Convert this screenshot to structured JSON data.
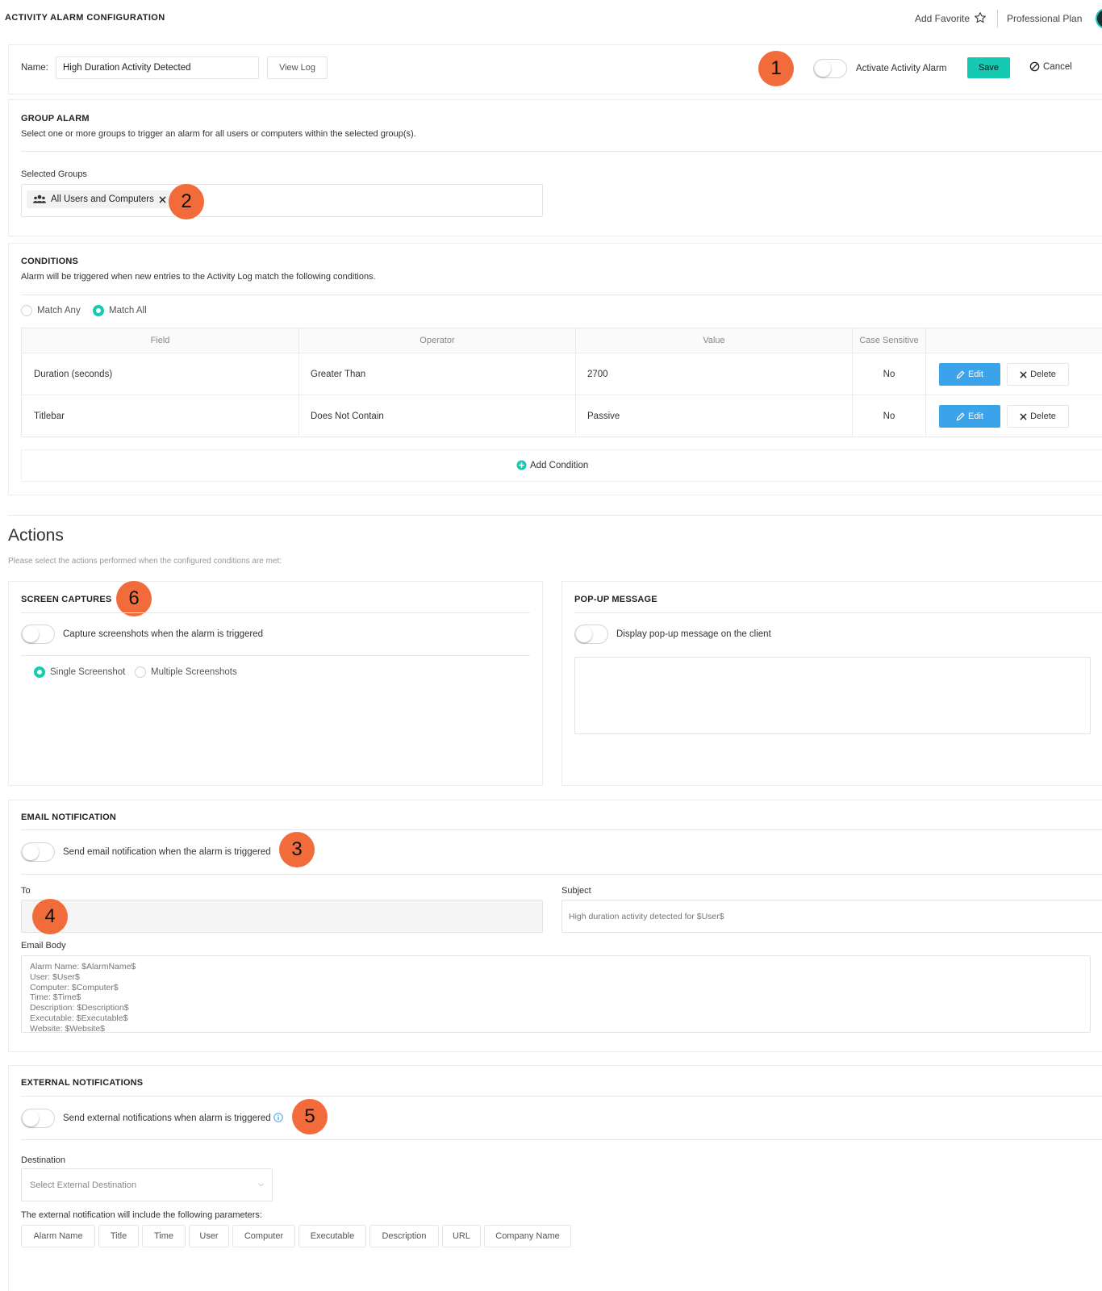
{
  "header": {
    "title": "ACTIVITY ALARM CONFIGURATION",
    "add_favorite": "Add Favorite",
    "plan": "Professional Plan"
  },
  "top_bar": {
    "name_label": "Name:",
    "name_value": "High Duration Activity Detected",
    "view_log": "View Log",
    "activate_label": "Activate Activity Alarm",
    "save": "Save",
    "cancel": "Cancel"
  },
  "markers": [
    "1",
    "2",
    "3",
    "4",
    "5",
    "6"
  ],
  "group_alarm": {
    "title": "GROUP ALARM",
    "description": "Select one or more groups to trigger an alarm for all users or computers within the selected group(s).",
    "selected_label": "Selected Groups",
    "chip": "All Users and Computers"
  },
  "conditions": {
    "title": "CONDITIONS",
    "description": "Alarm will be triggered when new entries to the Activity Log match the following conditions.",
    "match_any": "Match Any",
    "match_all": "Match All",
    "selected_match": "all",
    "columns": [
      "Field",
      "Operator",
      "Value",
      "Case Sensitive"
    ],
    "rows": [
      {
        "field": "Duration (seconds)",
        "operator": "Greater Than",
        "value": "2700",
        "case_sensitive": "No"
      },
      {
        "field": "Titlebar",
        "operator": "Does Not Contain",
        "value": "Passive",
        "case_sensitive": "No"
      }
    ],
    "edit": "Edit",
    "delete": "Delete",
    "add_condition": "Add Condition"
  },
  "actions": {
    "title": "Actions",
    "description": "Please select the actions performed when the configured conditions are met:"
  },
  "screen_captures": {
    "title": "SCREEN CAPTURES",
    "toggle_label": "Capture screenshots when the alarm is triggered",
    "single": "Single Screenshot",
    "multiple": "Multiple Screenshots"
  },
  "popup": {
    "title": "POP-UP MESSAGE",
    "toggle_label": "Display pop-up message on the client"
  },
  "email": {
    "title": "EMAIL NOTIFICATION",
    "toggle_label": "Send email notification when the alarm is triggered",
    "to_label": "To",
    "subject_label": "Subject",
    "subject_placeholder": "High duration activity detected for $User$",
    "body_label": "Email Body",
    "body_placeholder": "Alarm Name: $AlarmName$\nUser: $User$\nComputer: $Computer$\nTime: $Time$\nDescription: $Description$\nExecutable: $Executable$\nWebsite: $Website$"
  },
  "external": {
    "title": "EXTERNAL NOTIFICATIONS",
    "toggle_label": "Send external notifications when alarm is triggered",
    "destination_label": "Destination",
    "destination_placeholder": "Select External Destination",
    "params_label": "The external notification will include the following parameters:",
    "params": [
      "Alarm Name",
      "Title",
      "Time",
      "User",
      "Computer",
      "Executable",
      "Description",
      "URL",
      "Company Name"
    ]
  },
  "colors": {
    "accent": "#16c9b3",
    "edit_blue": "#3aa3ea",
    "marker": "#f26b3a"
  }
}
